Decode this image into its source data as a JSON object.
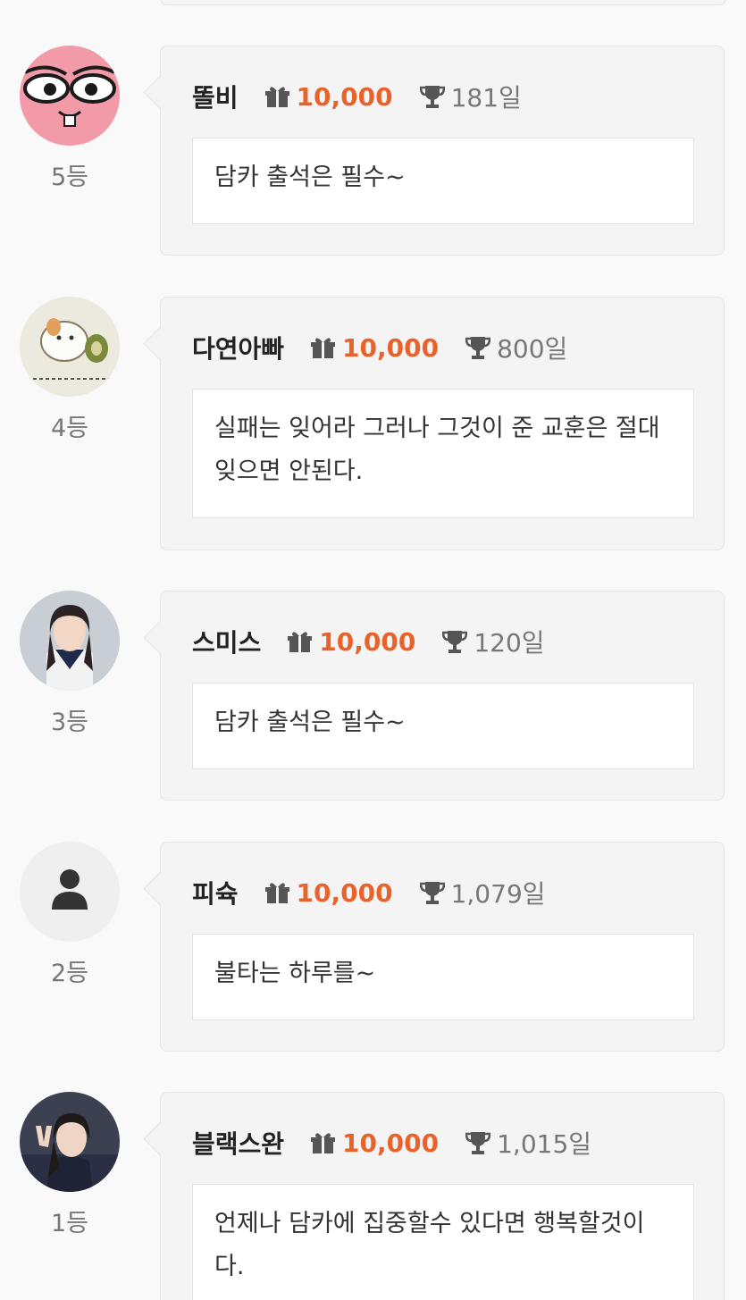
{
  "entries": [
    {
      "rank": "5등",
      "name": "똘비",
      "points": "10,000",
      "days": "181일",
      "message": "담카 출석은 필수~",
      "avatar": "pink-cartoon-face"
    },
    {
      "rank": "4등",
      "name": "다연아빠",
      "points": "10,000",
      "days": "800일",
      "message": "실패는 잊어라 그러나 그것이 준 교훈은 절대 잊으면 안된다.",
      "avatar": "hamster-drawing"
    },
    {
      "rank": "3등",
      "name": "스미스",
      "points": "10,000",
      "days": "120일",
      "message": "담카 출석은 필수~",
      "avatar": "photo-girl-sailor"
    },
    {
      "rank": "2등",
      "name": "피슉",
      "points": "10,000",
      "days": "1,079일",
      "message": "불타는 하루를~",
      "avatar": "default-user-icon"
    },
    {
      "rank": "1등",
      "name": "블랙스완",
      "points": "10,000",
      "days": "1,015일",
      "message": "언제나 담카에 집중할수 있다면 행복할것이다.",
      "avatar": "photo-girl-peace-sign"
    }
  ],
  "colors": {
    "points": "#e8632b",
    "card_bg": "#f4f4f4",
    "page_bg": "#f9f9f9"
  },
  "icons": {
    "gift": "gift-icon",
    "trophy": "trophy-icon"
  }
}
